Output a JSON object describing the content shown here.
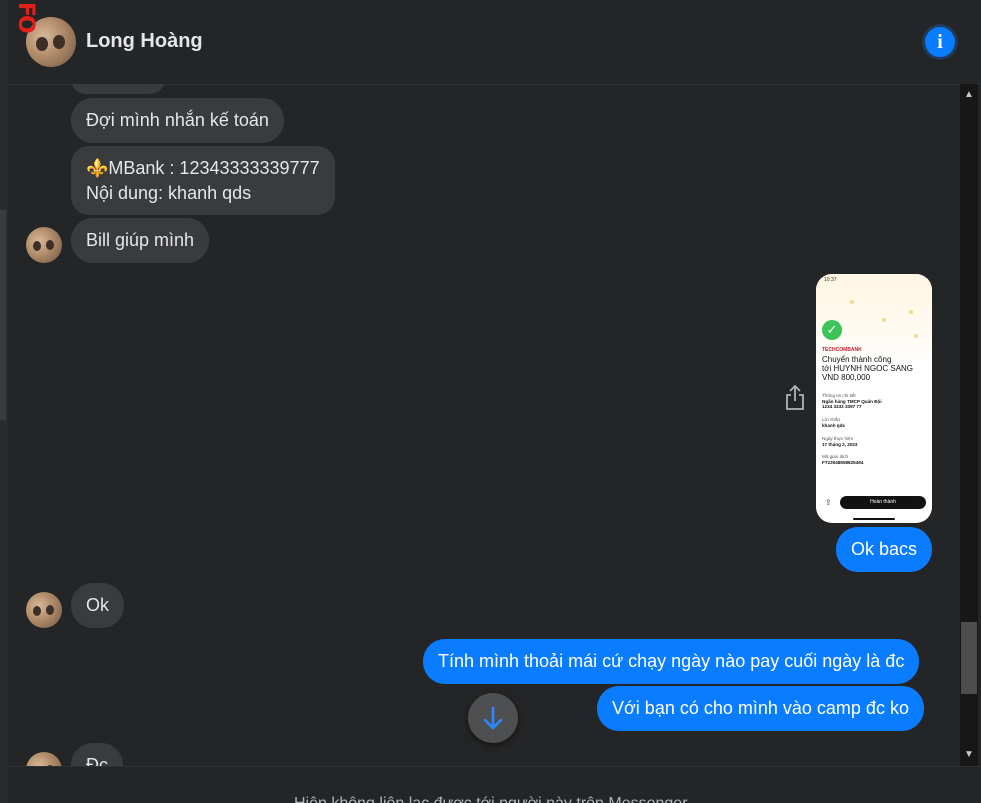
{
  "header": {
    "contact_name": "Long Hoàng",
    "badge_text": "FO",
    "info_icon": "info-icon",
    "accent_color": "#0a7cff"
  },
  "messages": [
    {
      "direction": "in",
      "text": "Đợi mình nhắn kế toán"
    },
    {
      "direction": "in",
      "lines": [
        "⚜️MBank : 12343333339777",
        "Nội dung: khanh qds"
      ]
    },
    {
      "direction": "in",
      "text": "Bill giúp mình"
    },
    {
      "direction": "out",
      "type": "image",
      "receipt": {
        "time": "10:37",
        "bank": "TECHCOMBANK",
        "title_lines": [
          "Chuyển thành công",
          "tới HUYNH NGOC SANG",
          "VND 800,000"
        ],
        "info_label": "Thông tin chi tiết",
        "info_bank": "Ngân hàng TMCP Quân Đội",
        "info_account": "1234 3333 3397 77",
        "message_label": "Lời nhắn",
        "message_value": "khanh qds",
        "date_label": "Ngày thực hiện",
        "date_value": "17 tháng 2, 2023",
        "tx_label": "Mã giao dịch",
        "tx_value": "FT23048558825494",
        "done_button": "Hoàn thành"
      }
    },
    {
      "direction": "out",
      "text": "Ok bacs"
    },
    {
      "direction": "in",
      "text": "Ok"
    },
    {
      "direction": "out",
      "text": "Tính mình thoải mái cứ chạy ngày nào pay cuối ngày là đc"
    },
    {
      "direction": "out",
      "text": "Với bạn có cho mình vào camp đc ko"
    },
    {
      "direction": "in",
      "text": "Đc"
    }
  ],
  "scroll_down_icon": "arrow-down-icon",
  "share_icon": "share-icon",
  "composer": {
    "note": "Hiện không liên lạc được tới người này trên Messenger."
  },
  "colors": {
    "incoming_bubble": "#3a3b3c",
    "outgoing_bubble": "#0a7cff",
    "background": "#242526"
  }
}
